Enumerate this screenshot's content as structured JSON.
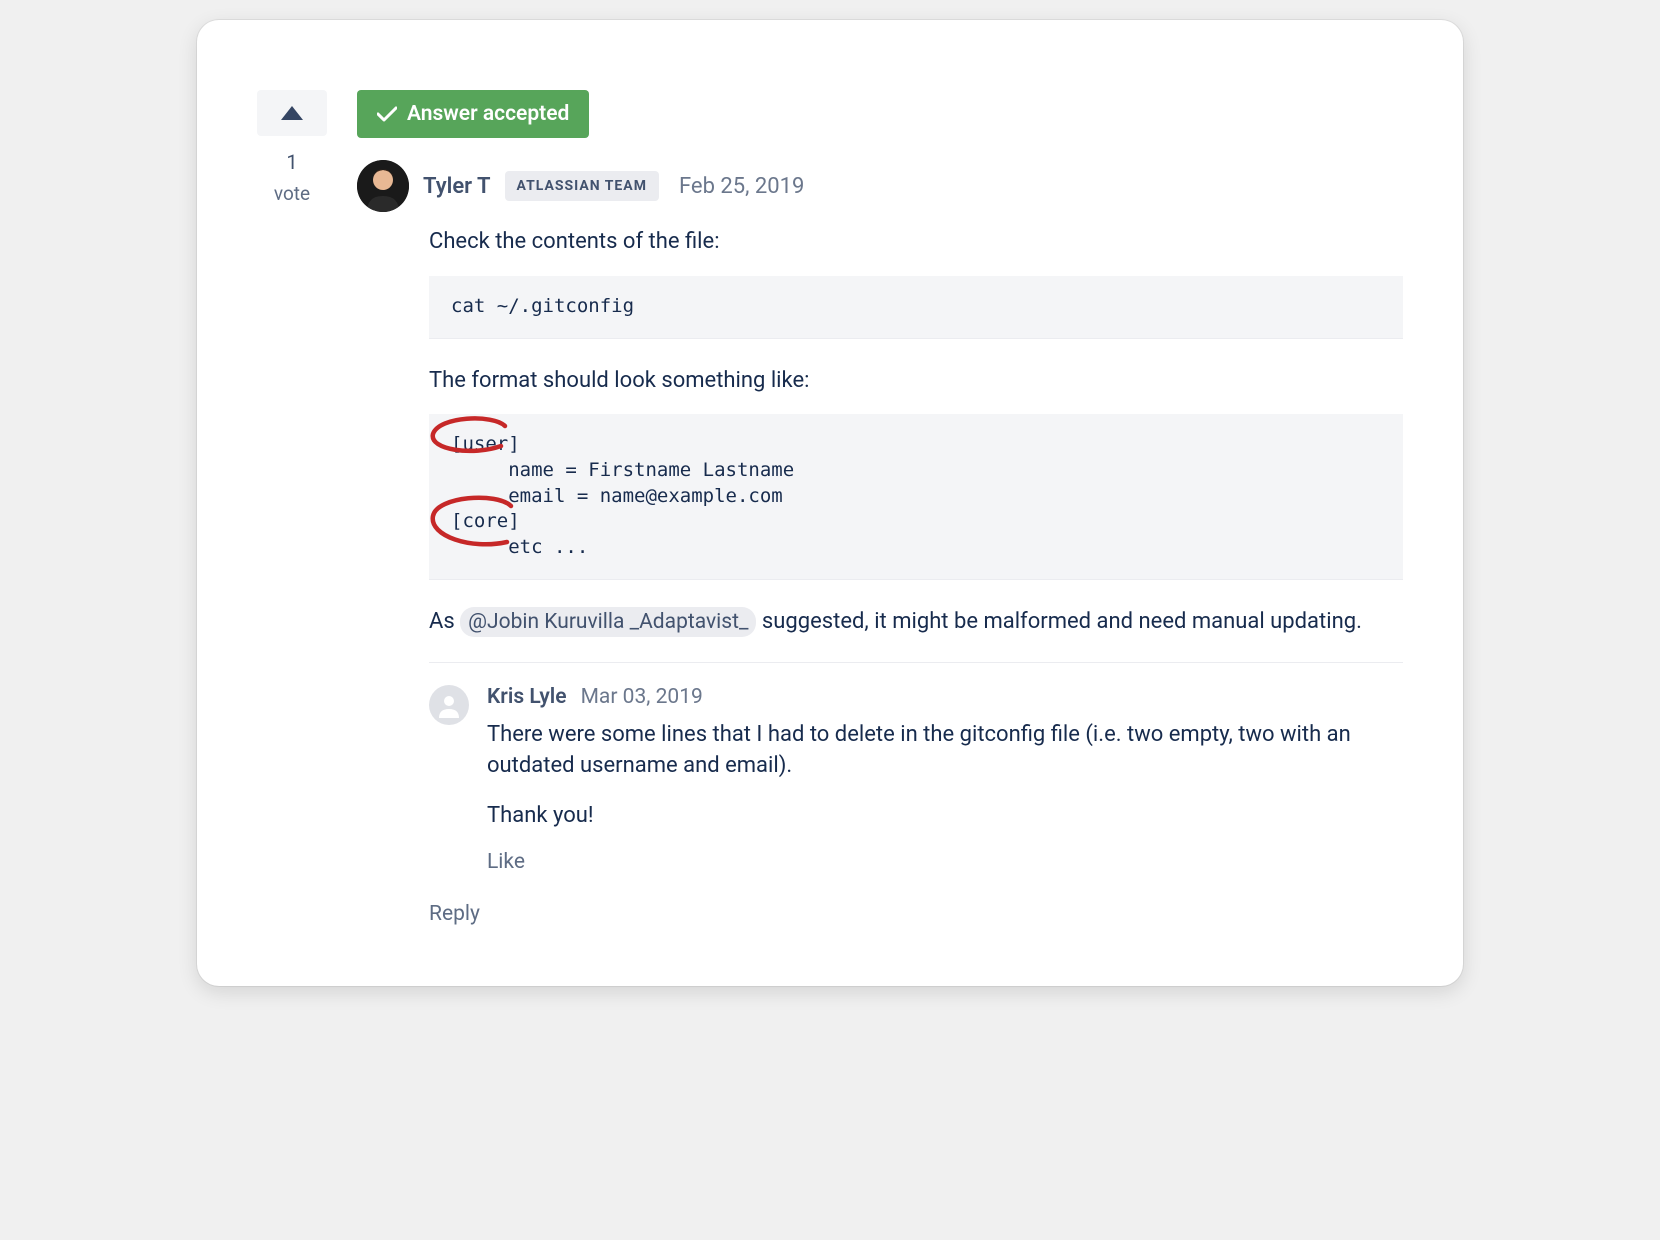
{
  "vote": {
    "count": "1",
    "label": "vote"
  },
  "accepted_badge": "Answer accepted",
  "answer": {
    "author": "Tyler T",
    "team_badge": "ATLASSIAN TEAM",
    "date": "Feb 25, 2019",
    "intro": "Check the contents of the file:",
    "code1": "cat ~/.gitconfig",
    "format_label": "The format should look something like:",
    "code2": "[user]\n     name = Firstname Lastname\n     email = name@example.com\n[core]\n     etc ...",
    "closing_pre": "As ",
    "mention": "@Jobin Kuruvilla _Adaptavist_",
    "closing_post": " suggested, it might be malformed and need manual updating."
  },
  "comment": {
    "author": "Kris Lyle",
    "date": "Mar 03, 2019",
    "text1": "There were some lines that I had to delete in the gitconfig file (i.e. two empty, two with an outdated username and email).",
    "text2": "Thank you!",
    "like_label": "Like"
  },
  "reply_label": "Reply"
}
